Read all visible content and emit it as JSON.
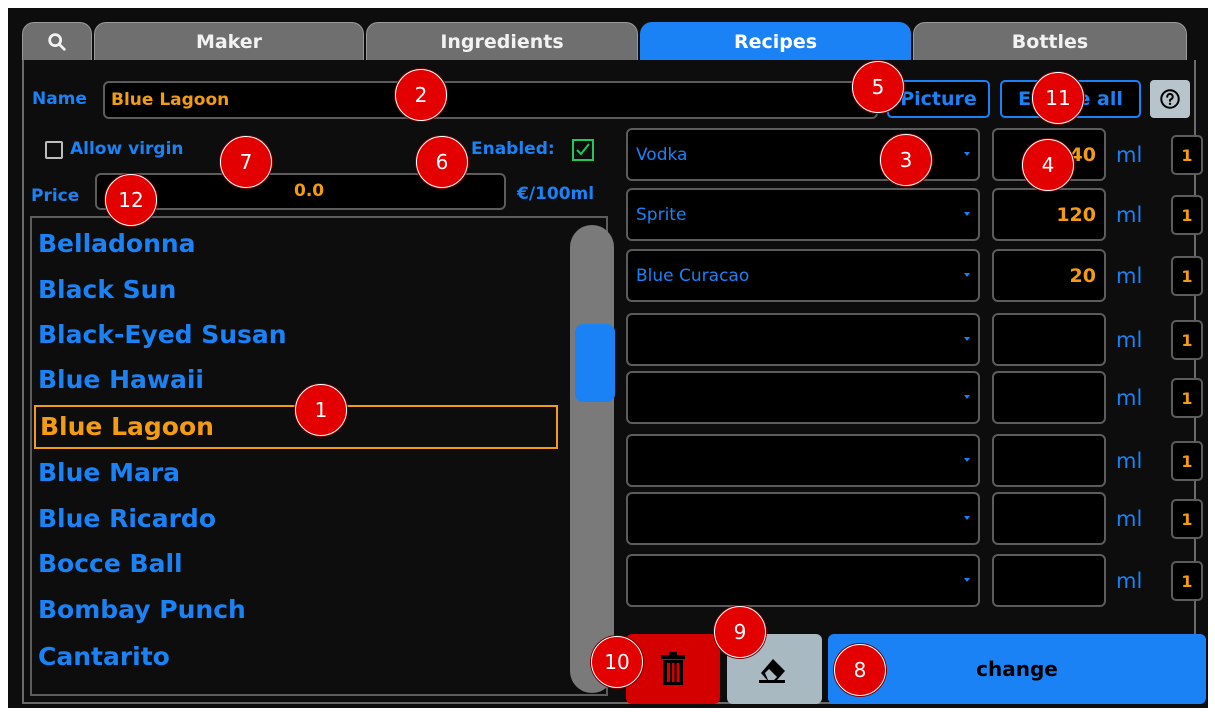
{
  "tabs": [
    {
      "label": "Maker"
    },
    {
      "label": "Ingredients"
    },
    {
      "label": "Recipes",
      "active": true
    },
    {
      "label": "Bottles"
    }
  ],
  "search_icon": "magnifier-icon",
  "recipe": {
    "name_label": "Name",
    "name_value": "Blue Lagoon",
    "picture_button": "Picture",
    "enable_all_button": "Enable all",
    "help_icon": "question-circle-icon",
    "allow_virgin_label": "Allow virgin",
    "allow_virgin_checked": false,
    "enabled_label": "Enabled:",
    "enabled_checked": true,
    "price_label": "Price",
    "price_value": "0.0",
    "price_unit": "€/100ml"
  },
  "recipe_list": [
    "Belladonna",
    "Black Sun",
    "Black-Eyed Susan",
    "Blue Hawaii",
    "Blue Lagoon",
    "Blue Mara",
    "Blue Ricardo",
    "Bocce Ball",
    "Bombay Punch",
    "Cantarito"
  ],
  "selected_recipe": "Blue Lagoon",
  "ingredients": [
    {
      "name": "Vodka",
      "amount": "40",
      "unit": "ml",
      "hand": "1"
    },
    {
      "name": "Sprite",
      "amount": "120",
      "unit": "ml",
      "hand": "1"
    },
    {
      "name": "Blue Curacao",
      "amount": "20",
      "unit": "ml",
      "hand": "1"
    },
    {
      "name": "",
      "amount": "",
      "unit": "ml",
      "hand": "1"
    },
    {
      "name": "",
      "amount": "",
      "unit": "ml",
      "hand": "1"
    },
    {
      "name": "",
      "amount": "",
      "unit": "ml",
      "hand": "1"
    },
    {
      "name": "",
      "amount": "",
      "unit": "ml",
      "hand": "1"
    },
    {
      "name": "",
      "amount": "",
      "unit": "ml",
      "hand": "1"
    }
  ],
  "actions": {
    "delete_icon": "trash-icon",
    "clear_icon": "eraser-icon",
    "change_label": "change"
  },
  "markers": [
    "1",
    "2",
    "3",
    "4",
    "5",
    "6",
    "7",
    "8",
    "9",
    "10",
    "11",
    "12"
  ],
  "colors": {
    "accent": "#1a82f5",
    "highlight": "#f39c12",
    "danger": "#d40000",
    "marker": "#e30000",
    "background": "#0d0d0d"
  }
}
